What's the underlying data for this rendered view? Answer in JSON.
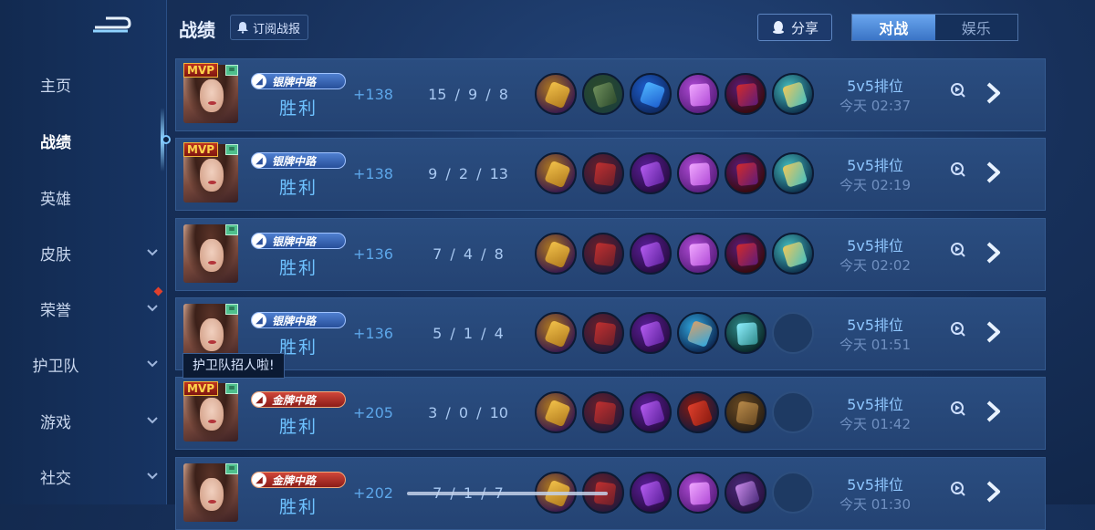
{
  "header": {
    "title": "战绩",
    "subscribe_label": "订阅战报",
    "share_label": "分享",
    "tabs": [
      {
        "label": "对战",
        "active": true
      },
      {
        "label": "娱乐",
        "active": false
      }
    ]
  },
  "sidebar": {
    "items": [
      {
        "label": "主页",
        "active": false,
        "chevron": false
      },
      {
        "label": "战绩",
        "active": true,
        "chevron": false
      },
      {
        "label": "英雄",
        "active": false,
        "chevron": false
      },
      {
        "label": "皮肤",
        "active": false,
        "chevron": true
      },
      {
        "label": "荣誉",
        "active": false,
        "chevron": true,
        "red_dot": true
      },
      {
        "label": "护卫队",
        "active": false,
        "chevron": true
      },
      {
        "label": "游戏",
        "active": false,
        "chevron": true
      },
      {
        "label": "社交",
        "active": false,
        "chevron": true
      }
    ],
    "tooltip": "护卫队招人啦!"
  },
  "matches": [
    {
      "mvp": true,
      "mvp_label": "MVP",
      "rank_label": "银牌中路",
      "rank_tier": "silver",
      "result": "胜利",
      "points": "+138",
      "kda": "15 / 9 / 8",
      "mode": "5v5排位",
      "time": "今天 02:37",
      "items": [
        "golden-chalice-icon",
        "green-boots-icon",
        "blue-lance-icon",
        "purple-blade-icon",
        "red-mask-icon",
        "gold-amulet-icon"
      ]
    },
    {
      "mvp": true,
      "mvp_label": "MVP",
      "rank_label": "银牌中路",
      "rank_tier": "silver",
      "result": "胜利",
      "points": "+138",
      "kda": "9 / 2 / 13",
      "mode": "5v5排位",
      "time": "今天 02:19",
      "items": [
        "golden-chalice-icon",
        "red-boots-icon",
        "purple-claw-icon",
        "purple-blade-icon",
        "red-mask-icon",
        "gold-amulet-icon"
      ]
    },
    {
      "mvp": false,
      "mvp_label": "",
      "rank_label": "银牌中路",
      "rank_tier": "silver",
      "result": "胜利",
      "points": "+136",
      "kda": "7 / 4 / 8",
      "mode": "5v5排位",
      "time": "今天 02:02",
      "items": [
        "golden-chalice-icon",
        "red-boots-icon",
        "purple-claw-icon",
        "purple-blade-icon",
        "red-mask-icon",
        "gold-amulet-icon"
      ]
    },
    {
      "mvp": false,
      "mvp_label": "",
      "rank_label": "银牌中路",
      "rank_tier": "silver",
      "result": "胜利",
      "points": "+136",
      "kda": "5 / 1 / 4",
      "mode": "5v5排位",
      "time": "今天 01:51",
      "items": [
        "golden-chalice-icon",
        "red-boots-icon",
        "purple-claw-icon",
        "blue-staff-icon",
        "crystal-wand-icon",
        "empty-slot"
      ]
    },
    {
      "mvp": true,
      "mvp_label": "MVP",
      "rank_label": "金牌中路",
      "rank_tier": "gold",
      "result": "胜利",
      "points": "+205",
      "kda": "3 / 0 / 10",
      "mode": "5v5排位",
      "time": "今天 01:42",
      "items": [
        "golden-chalice-icon",
        "red-boots-icon",
        "purple-claw-icon",
        "red-gem-icon",
        "wooden-shield-icon",
        "empty-slot"
      ]
    },
    {
      "mvp": false,
      "mvp_label": "",
      "rank_label": "金牌中路",
      "rank_tier": "gold",
      "result": "胜利",
      "points": "+202",
      "kda": "7 / 1 / 7",
      "mode": "5v5排位",
      "time": "今天 01:30",
      "items": [
        "golden-chalice-icon",
        "red-boots-icon",
        "purple-claw-icon",
        "purple-blade-icon",
        "purple-tome-icon",
        "empty-slot"
      ]
    }
  ],
  "colors": {
    "accent_blue": "#6ec2ff",
    "gold_rank": "#d0473a",
    "silver_rank": "#4f7fd0"
  }
}
